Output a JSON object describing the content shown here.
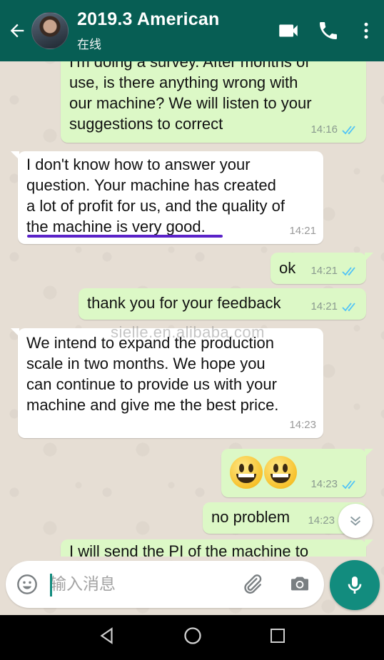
{
  "header": {
    "contact_name": "2019.3 American",
    "status": "在线",
    "icons": [
      "back-arrow-icon",
      "video-call-icon",
      "phone-icon",
      "more-vert-icon"
    ],
    "color": "#075e54"
  },
  "messages": [
    {
      "direction": "out",
      "lines": [
        "I'm doing a survey. After months of",
        "use, is there anything wrong with",
        "our machine?  We will listen to your",
        "suggestions to correct"
      ],
      "time": "14:16",
      "ticks": "read"
    },
    {
      "direction": "in",
      "lines": [
        "I don't know how to answer your",
        "question.  Your machine has created",
        "a lot of profit for us, and the quality of",
        "the machine is very good."
      ],
      "time": "14:21"
    },
    {
      "direction": "out",
      "lines": [
        "ok"
      ],
      "time": "14:21",
      "ticks": "read"
    },
    {
      "direction": "out",
      "lines": [
        "thank you for your feedback"
      ],
      "time": "14:21",
      "ticks": "read"
    },
    {
      "direction": "in",
      "lines": [
        "We intend to expand the production",
        "scale in two months. We hope you",
        "can continue to provide us with your",
        "machine and give me the best price."
      ],
      "time": "14:23"
    },
    {
      "direction": "out",
      "emoji_count": 2,
      "time": "14:23",
      "ticks": "read"
    },
    {
      "direction": "out",
      "lines": [
        "no problem"
      ],
      "time": "14:23"
    },
    {
      "direction": "out",
      "lines": [
        "I will send the PI of the machine to"
      ]
    }
  ],
  "watermark": "sielle.en.alibaba.com",
  "composer": {
    "placeholder": "输入消息",
    "icons": [
      "emoji-icon",
      "attach-icon",
      "camera-icon",
      "mic-icon"
    ],
    "accent": "#128c7e"
  },
  "colors": {
    "outgoing_bubble": "#dcf8c6",
    "incoming_bubble": "#ffffff",
    "read_tick": "#4fc3f7"
  }
}
